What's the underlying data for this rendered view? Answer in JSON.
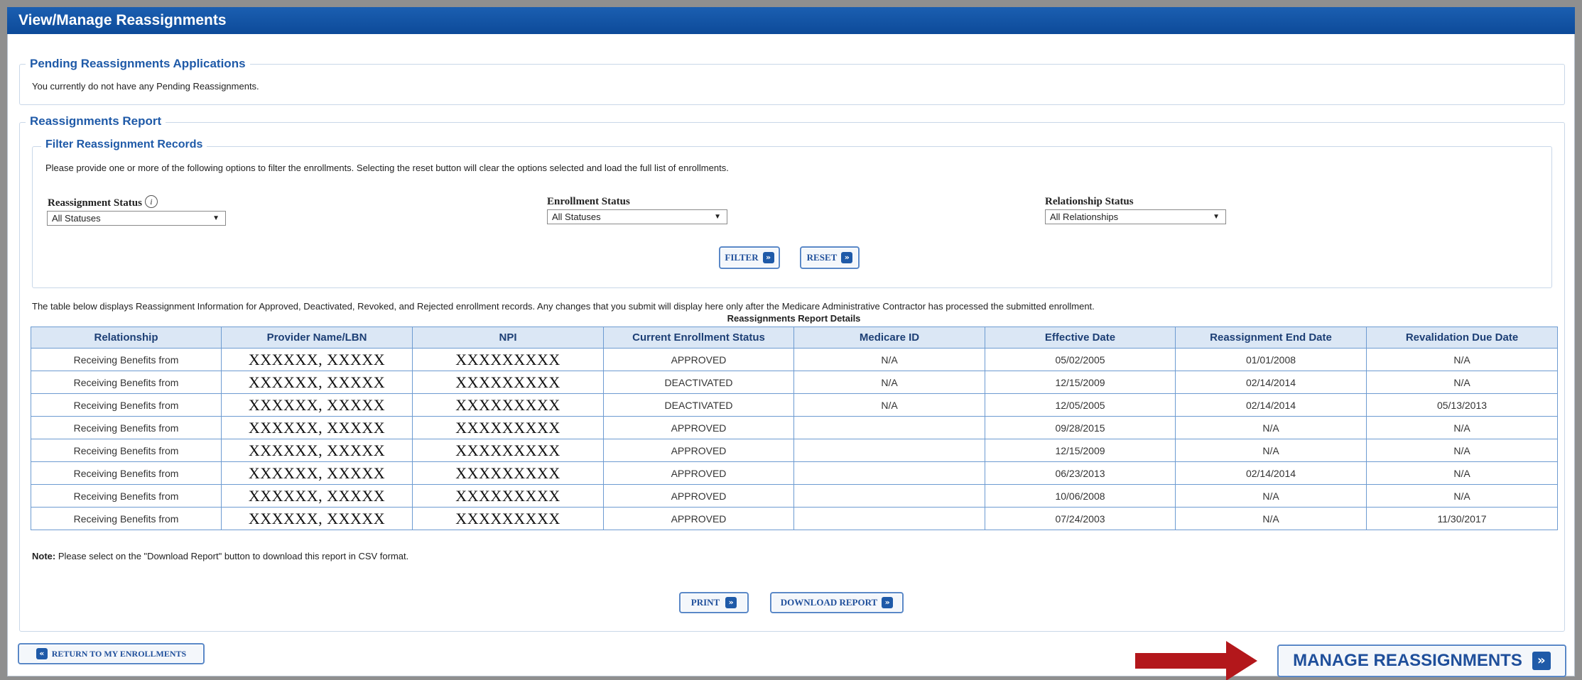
{
  "window": {
    "title": "View/Manage Reassignments"
  },
  "pending": {
    "legend": "Pending Reassignments Applications",
    "message": "You currently do not have any Pending Reassignments."
  },
  "report": {
    "legend": "Reassignments Report",
    "filter": {
      "legend": "Filter Reassignment Records",
      "instructions": "Please provide one or more of the following options to filter the enrollments. Selecting the reset button will clear the options selected and load the full list of enrollments.",
      "reassignment_status_label": "Reassignment Status",
      "reassignment_status_value": "All Statuses",
      "enrollment_status_label": "Enrollment Status",
      "enrollment_status_value": "All Statuses",
      "relationship_status_label": "Relationship Status",
      "relationship_status_value": "All Relationships",
      "filter_button": "FILTER",
      "reset_button": "RESET"
    },
    "table_intro": "The table below displays Reassignment Information for Approved, Deactivated, Revoked, and Rejected enrollment records. Any changes that you submit will display here only after the Medicare Administrative Contractor has processed the submitted enrollment.",
    "table_caption": "Reassignments Report Details",
    "columns": [
      "Relationship",
      "Provider Name/LBN",
      "NPI",
      "Current Enrollment Status",
      "Medicare ID",
      "Effective Date",
      "Reassignment End Date",
      "Revalidation Due Date"
    ],
    "rows": [
      [
        "Receiving Benefits from",
        "XXXXXX, XXXXX",
        "XXXXXXXXX",
        "APPROVED",
        "N/A",
        "05/02/2005",
        "01/01/2008",
        "N/A"
      ],
      [
        "Receiving Benefits from",
        "XXXXXX, XXXXX",
        "XXXXXXXXX",
        "DEACTIVATED",
        "N/A",
        "12/15/2009",
        "02/14/2014",
        "N/A"
      ],
      [
        "Receiving Benefits from",
        "XXXXXX, XXXXX",
        "XXXXXXXXX",
        "DEACTIVATED",
        "N/A",
        "12/05/2005",
        "02/14/2014",
        "05/13/2013"
      ],
      [
        "Receiving Benefits from",
        "XXXXXX, XXXXX",
        "XXXXXXXXX",
        "APPROVED",
        "",
        "09/28/2015",
        "N/A",
        "N/A"
      ],
      [
        "Receiving Benefits from",
        "XXXXXX, XXXXX",
        "XXXXXXXXX",
        "APPROVED",
        "",
        "12/15/2009",
        "N/A",
        "N/A"
      ],
      [
        "Receiving Benefits from",
        "XXXXXX, XXXXX",
        "XXXXXXXXX",
        "APPROVED",
        "",
        "06/23/2013",
        "02/14/2014",
        "N/A"
      ],
      [
        "Receiving Benefits from",
        "XXXXXX, XXXXX",
        "XXXXXXXXX",
        "APPROVED",
        "",
        "10/06/2008",
        "N/A",
        "N/A"
      ],
      [
        "Receiving Benefits from",
        "XXXXXX, XXXXX",
        "XXXXXXXXX",
        "APPROVED",
        "",
        "07/24/2003",
        "N/A",
        "11/30/2017"
      ]
    ],
    "note_label": "Note:",
    "note_text": "Please select on the \"Download Report\" button to download this report in CSV format.",
    "print_button": "PRINT",
    "download_button": "DOWNLOAD REPORT"
  },
  "footer": {
    "return_button": "RETURN TO MY ENROLLMENTS",
    "manage_button": "MANAGE REASSIGNMENTS"
  },
  "icons": {
    "chevron": "»",
    "info": "i",
    "dropdown": "▼"
  },
  "colors": {
    "titlebar": "#0d4a99",
    "accent": "#1f5aa8",
    "annotation_arrow": "#b3171b"
  }
}
